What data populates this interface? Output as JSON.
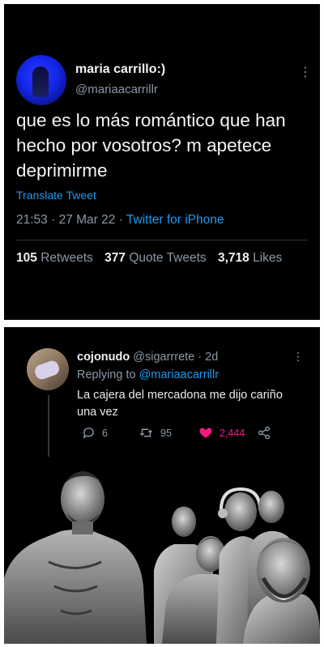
{
  "tweet": {
    "display_name": "maria carrillo:)",
    "handle": "@mariaacarrillr",
    "text": "que es lo más romántico que han hecho por vosotros? m apetece deprimirme",
    "translate_label": "Translate Tweet",
    "time": "21:53",
    "date": "27 Mar 22",
    "source": "Twitter for iPhone",
    "stats": {
      "retweets_count": "105",
      "retweets_label": "Retweets",
      "quotes_count": "377",
      "quotes_label": "Quote Tweets",
      "likes_count": "3,718",
      "likes_label": "Likes"
    }
  },
  "reply": {
    "display_name": "cojonudo",
    "handle": "@sigarrrete",
    "age": "· 2d",
    "replying_label": "Replying to",
    "replying_to": "@mariaacarrillr",
    "text": "La cajera del mercadona me dijo cariño una vez",
    "actions": {
      "replies": "6",
      "retweets": "95",
      "likes": "2,444"
    }
  },
  "icons": [
    "more-icon",
    "reply-icon",
    "retweet-icon",
    "heart-icon",
    "share-icon"
  ],
  "colors": {
    "background": "#000000",
    "link": "#1d9bf0",
    "muted": "#8b98a5",
    "like": "#f91880"
  }
}
